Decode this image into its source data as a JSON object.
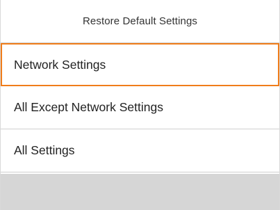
{
  "header": {
    "title": "Restore Default Settings"
  },
  "menu": {
    "items": [
      {
        "label": "Network Settings",
        "selected": true
      },
      {
        "label": "All Except Network Settings",
        "selected": false
      },
      {
        "label": "All Settings",
        "selected": false
      }
    ]
  },
  "colors": {
    "selection_border": "#f07d1a",
    "footer_bar": "#d6d6d6",
    "divider": "#cfcfcf"
  }
}
